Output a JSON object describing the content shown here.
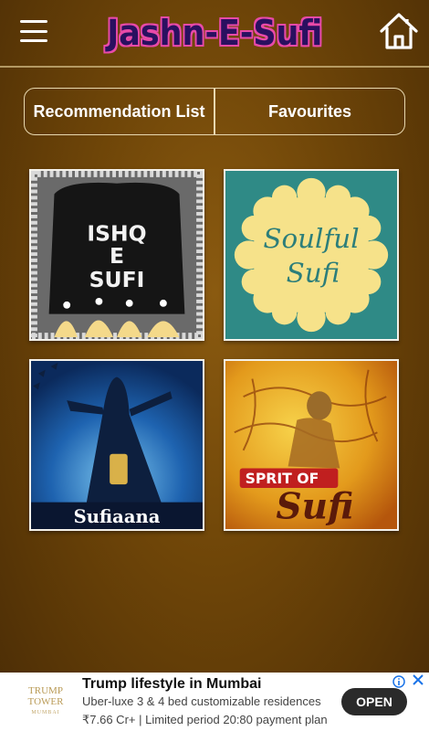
{
  "header": {
    "title": "Jashn-E-Sufi",
    "menu_icon": "hamburger-menu-icon",
    "home_icon": "home-icon"
  },
  "tabs": [
    {
      "label": "Recommendation List"
    },
    {
      "label": "Favourites"
    }
  ],
  "albums": [
    {
      "lines": [
        "ISHQ",
        "E",
        "SUFI"
      ]
    },
    {
      "lines": [
        "Soulful",
        "Sufi"
      ]
    },
    {
      "lines": [
        "Sufiaana"
      ]
    },
    {
      "lines": [
        "SPRIT OF",
        "Sufi"
      ]
    }
  ],
  "ad": {
    "logo_line1": "TRUMP",
    "logo_line2": "TOWER",
    "logo_sub": "MUMBAI",
    "title": "Trump lifestyle in Mumbai",
    "line1": "Uber-luxe 3 & 4 bed customizable residences",
    "line2": "₹7.66 Cr+ | Limited period 20:80 payment plan",
    "cta": "OPEN",
    "info_icon": "info-icon",
    "close_icon": "close-icon"
  },
  "colors": {
    "background": "#6e4508",
    "title_fill": "#2a1060",
    "title_outline": "#e84aa8",
    "tab_border": "#e8d8b0"
  }
}
